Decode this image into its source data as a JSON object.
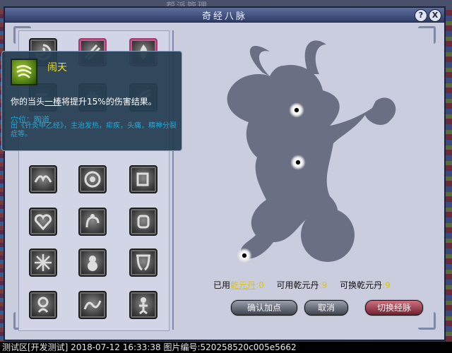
{
  "window": {
    "title": "奇经八脉",
    "help_label": "?",
    "close_label": "X",
    "background_caption": "帮派管理"
  },
  "tooltip": {
    "name": "闹天",
    "description_before": "你的当头",
    "description_underlined": "一棒",
    "description_after": "将提升15%的伤害结果。",
    "point_label": "穴位：陶道",
    "detail": "出《针灸甲乙经》，主治发热，疟疾，头痛，精神分裂症等。",
    "icon": "storm-icon"
  },
  "counters": {
    "used_label": "已用",
    "used_link": "乾元丹",
    "used_value": ":0",
    "available_label": "可用乾元丹",
    "available_value": ":9",
    "exchangeable_label": "可换乾元丹",
    "exchangeable_value": ":9"
  },
  "buttons": {
    "confirm": "确认加点",
    "cancel": "取消",
    "switch": "切换经脉"
  },
  "status_bar": {
    "text": "测试区[开发测试] 2018-07-12 16:33:38 图片编号:520258520c005e5662"
  },
  "colors": {
    "title_bg": "#2f3c66",
    "window_bg": "#c9cddd",
    "tooltip_name": "#f0e020",
    "tooltip_detail": "#28a8d8",
    "counter_highlight": "#e0c400",
    "switch_button": "#a03040"
  }
}
